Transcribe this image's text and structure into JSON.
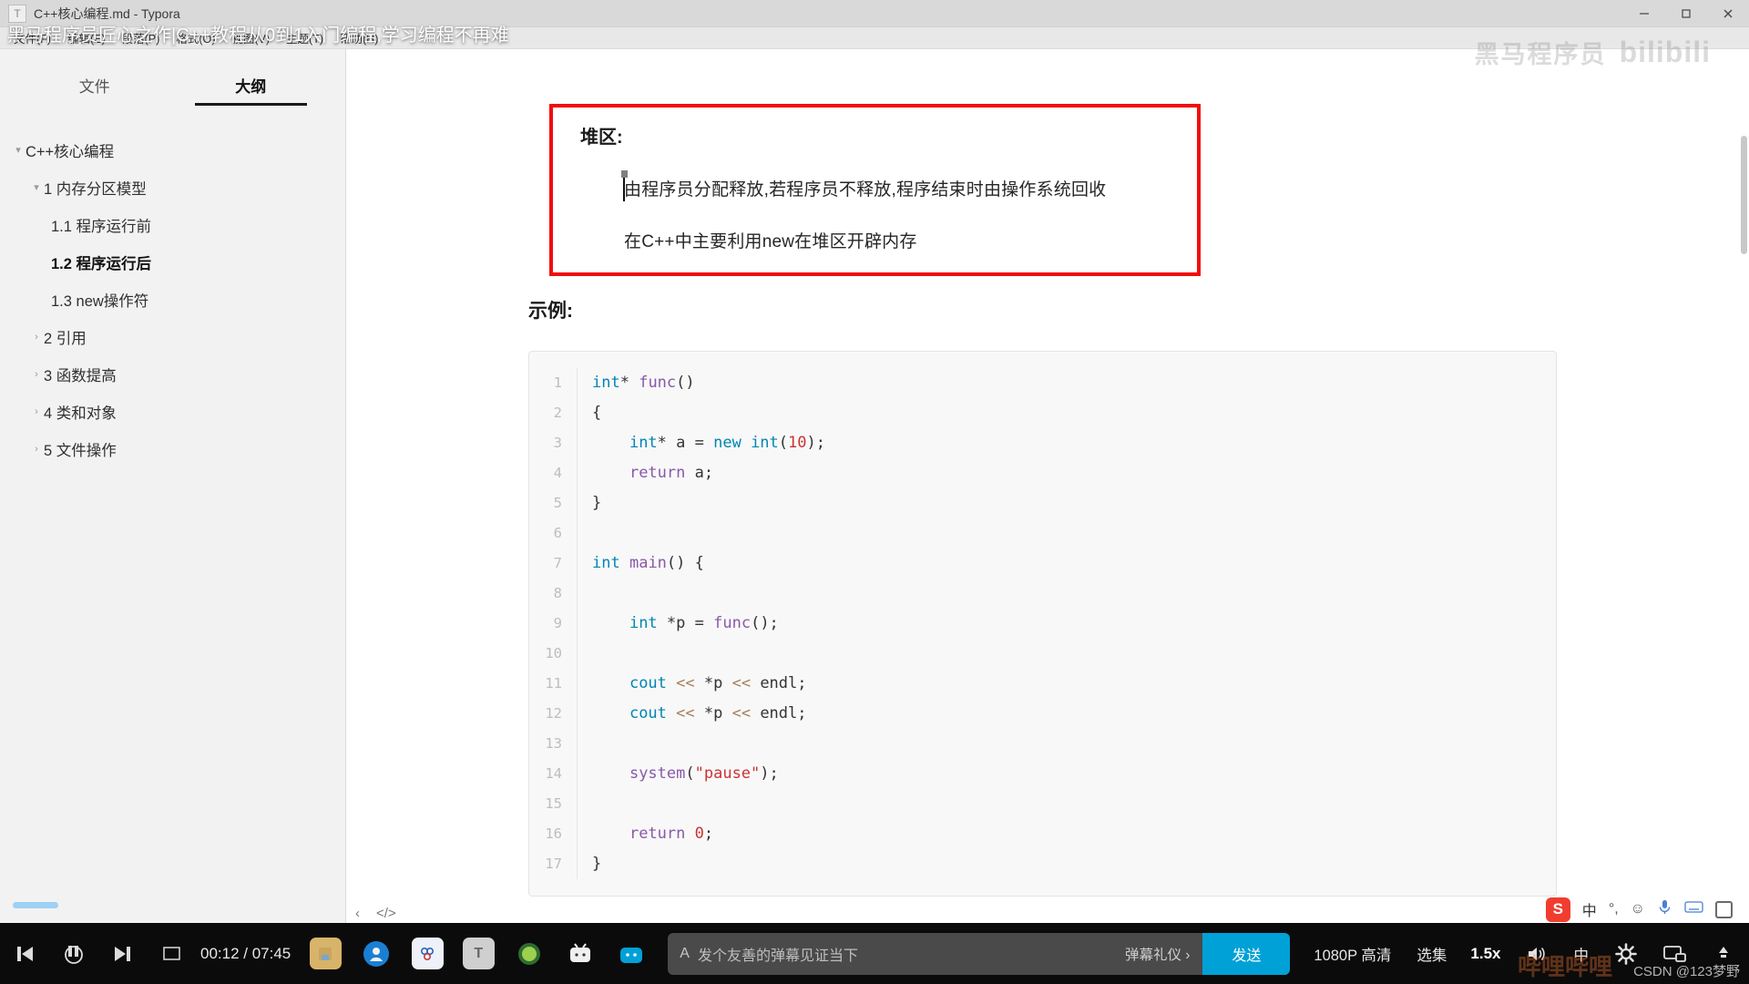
{
  "window": {
    "title": "C++核心编程.md - Typora",
    "app_icon": "T",
    "controls": {
      "minimize": "minimize-icon",
      "maximize": "maximize-icon",
      "close": "close-icon"
    }
  },
  "menubar": {
    "items": [
      "文件(F)",
      "编辑(E)",
      "段落(P)",
      "格式(O)",
      "视图(V)",
      "主题(T)",
      "帮助(H)"
    ]
  },
  "video_overlay": {
    "title": "黑马程序员匠心之作|C++教程从0到1入门编程,学习编程不再难",
    "watermark_cn": "黑马程序员",
    "watermark_site": "bilibili"
  },
  "sidebar": {
    "tabs": [
      {
        "label": "文件",
        "active": false
      },
      {
        "label": "大纲",
        "active": true
      }
    ],
    "outline": [
      {
        "label": "C++核心编程",
        "level": 0,
        "caret": "expanded",
        "active": false
      },
      {
        "label": "1 内存分区模型",
        "level": 1,
        "caret": "expanded",
        "active": false
      },
      {
        "label": "1.1 程序运行前",
        "level": 2,
        "caret": "none",
        "active": false
      },
      {
        "label": "1.2 程序运行后",
        "level": 2,
        "caret": "none",
        "active": true
      },
      {
        "label": "1.3 new操作符",
        "level": 2,
        "caret": "none",
        "active": false
      },
      {
        "label": "2 引用",
        "level": 1,
        "caret": "collapsed",
        "active": false
      },
      {
        "label": "3 函数提高",
        "level": 1,
        "caret": "collapsed",
        "active": false
      },
      {
        "label": "4 类和对象",
        "level": 1,
        "caret": "collapsed",
        "active": false
      },
      {
        "label": "5 文件操作",
        "level": 1,
        "caret": "collapsed",
        "active": false
      }
    ]
  },
  "document": {
    "highlight_color": "#f20c0c",
    "heading": "堆区:",
    "paragraphs": [
      "由程序员分配释放,若程序员不释放,程序结束时由操作系统回收",
      "在C++中主要利用new在堆区开辟内存"
    ],
    "example_heading": "示例:",
    "code": [
      {
        "n": "1",
        "tokens": [
          {
            "t": "int",
            "c": "ty"
          },
          {
            "t": "* ",
            "c": "pl"
          },
          {
            "t": "func",
            "c": "fn"
          },
          {
            "t": "()",
            "c": "pl"
          }
        ]
      },
      {
        "n": "2",
        "tokens": [
          {
            "t": "{",
            "c": "pl"
          }
        ]
      },
      {
        "n": "3",
        "tokens": [
          {
            "t": "    ",
            "c": "pl"
          },
          {
            "t": "int",
            "c": "ty"
          },
          {
            "t": "* a = ",
            "c": "pl"
          },
          {
            "t": "new",
            "c": "kw"
          },
          {
            "t": " ",
            "c": "pl"
          },
          {
            "t": "int",
            "c": "ty"
          },
          {
            "t": "(",
            "c": "pl"
          },
          {
            "t": "10",
            "c": "nu"
          },
          {
            "t": ");",
            "c": "pl"
          }
        ]
      },
      {
        "n": "4",
        "tokens": [
          {
            "t": "    ",
            "c": "pl"
          },
          {
            "t": "return",
            "c": "fn"
          },
          {
            "t": " a;",
            "c": "pl"
          }
        ]
      },
      {
        "n": "5",
        "tokens": [
          {
            "t": "}",
            "c": "pl"
          }
        ]
      },
      {
        "n": "6",
        "tokens": [
          {
            "t": "",
            "c": "pl"
          }
        ]
      },
      {
        "n": "7",
        "tokens": [
          {
            "t": "int",
            "c": "ty"
          },
          {
            "t": " ",
            "c": "pl"
          },
          {
            "t": "main",
            "c": "fn"
          },
          {
            "t": "() {",
            "c": "pl"
          }
        ]
      },
      {
        "n": "8",
        "tokens": [
          {
            "t": "",
            "c": "pl"
          }
        ]
      },
      {
        "n": "9",
        "tokens": [
          {
            "t": "    ",
            "c": "pl"
          },
          {
            "t": "int",
            "c": "ty"
          },
          {
            "t": " *",
            "c": "pl"
          },
          {
            "t": "p",
            "c": "pl"
          },
          {
            "t": " = ",
            "c": "pl"
          },
          {
            "t": "func",
            "c": "fn"
          },
          {
            "t": "();",
            "c": "pl"
          }
        ]
      },
      {
        "n": "10",
        "tokens": [
          {
            "t": "",
            "c": "pl"
          }
        ]
      },
      {
        "n": "11",
        "tokens": [
          {
            "t": "    ",
            "c": "pl"
          },
          {
            "t": "cout",
            "c": "ty"
          },
          {
            "t": " ",
            "c": "pl"
          },
          {
            "t": "<<",
            "c": "op"
          },
          {
            "t": " *p ",
            "c": "pl"
          },
          {
            "t": "<<",
            "c": "op"
          },
          {
            "t": " endl;",
            "c": "pl"
          }
        ]
      },
      {
        "n": "12",
        "tokens": [
          {
            "t": "    ",
            "c": "pl"
          },
          {
            "t": "cout",
            "c": "ty"
          },
          {
            "t": " ",
            "c": "pl"
          },
          {
            "t": "<<",
            "c": "op"
          },
          {
            "t": " *p ",
            "c": "pl"
          },
          {
            "t": "<<",
            "c": "op"
          },
          {
            "t": " endl;",
            "c": "pl"
          }
        ]
      },
      {
        "n": "13",
        "tokens": [
          {
            "t": "",
            "c": "pl"
          }
        ]
      },
      {
        "n": "14",
        "tokens": [
          {
            "t": "    ",
            "c": "pl"
          },
          {
            "t": "system",
            "c": "fn"
          },
          {
            "t": "(",
            "c": "pl"
          },
          {
            "t": "\"pause\"",
            "c": "st"
          },
          {
            "t": ");",
            "c": "pl"
          }
        ]
      },
      {
        "n": "15",
        "tokens": [
          {
            "t": "",
            "c": "pl"
          }
        ]
      },
      {
        "n": "16",
        "tokens": [
          {
            "t": "    ",
            "c": "pl"
          },
          {
            "t": "return",
            "c": "fn"
          },
          {
            "t": " ",
            "c": "pl"
          },
          {
            "t": "0",
            "c": "nu"
          },
          {
            "t": ";",
            "c": "pl"
          }
        ]
      },
      {
        "n": "17",
        "tokens": [
          {
            "t": "}",
            "c": "pl"
          }
        ]
      }
    ]
  },
  "statusbar": {
    "prev_label": "‹",
    "source_label": "</>"
  },
  "ime": {
    "logo": "S",
    "lang": "中",
    "punct": "°,",
    "emoji": "☺",
    "mic": "mic-icon",
    "keyboard": "keyboard-icon",
    "box": "toolbox-icon"
  },
  "player": {
    "prev_label": "prev-icon",
    "pause_label": "pause-icon",
    "next_label": "next-icon",
    "pip_label": "pip-icon",
    "time": "00:12 / 07:45",
    "danmaku_placeholder": "发个友善的弹幕见证当下",
    "danmaku_rule": "弹幕礼仪 ›",
    "send_label": "发送",
    "quality": "1080P 高清",
    "episodes": "选集",
    "speed": "1.5x",
    "volume_label": "volume-icon",
    "subtitle_label": "中",
    "settings_label": "gear-icon",
    "widescreen_label": "widescreen-icon",
    "fullscreen_label": "fullscreen-icon",
    "accent": "#00a1d6"
  },
  "taskbar_apps": [
    {
      "name": "save-icon",
      "glyph": "",
      "color": "#d8b46a"
    },
    {
      "name": "browser-icon",
      "glyph": "",
      "color": "#1a7fd4"
    },
    {
      "name": "cloud-icon",
      "glyph": "",
      "color": "#e9eef6"
    },
    {
      "name": "typora-icon",
      "glyph": "T",
      "color": "#cfcfcf"
    },
    {
      "name": "mail-icon",
      "glyph": "",
      "color": "#6aa84f"
    },
    {
      "name": "bilibili-icon",
      "glyph": "",
      "color": "#f06292"
    },
    {
      "name": "bilibili-blue-icon",
      "glyph": "",
      "color": "#00a1d6"
    }
  ],
  "csdn_watermark": "CSDN @123梦野",
  "bili_watermark": "哔哩哔哩"
}
